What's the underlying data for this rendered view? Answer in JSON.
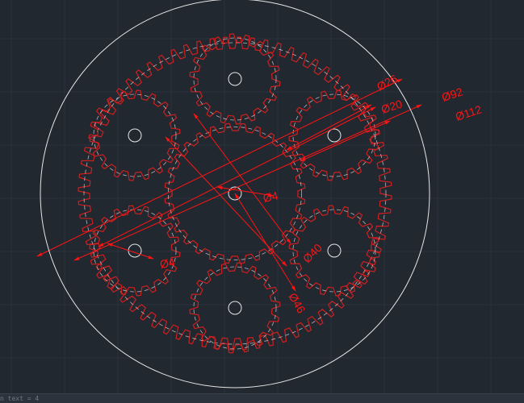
{
  "viewport": {
    "background": "#212830",
    "grid_color": "#2a323c",
    "outline_color": "#e6e6e6",
    "dimension_color": "#ff1414",
    "gear_color": "#cf1f1f"
  },
  "dimensions": {
    "d26": "Ø26",
    "d20": "Ø20",
    "d92": "Ø92",
    "d112": "Ø112",
    "d4_center": "Ø4",
    "d4_planet": "Ø4",
    "d40": "Ø40",
    "d46": "Ø46"
  },
  "command_line": {
    "text": "n text = 4"
  }
}
